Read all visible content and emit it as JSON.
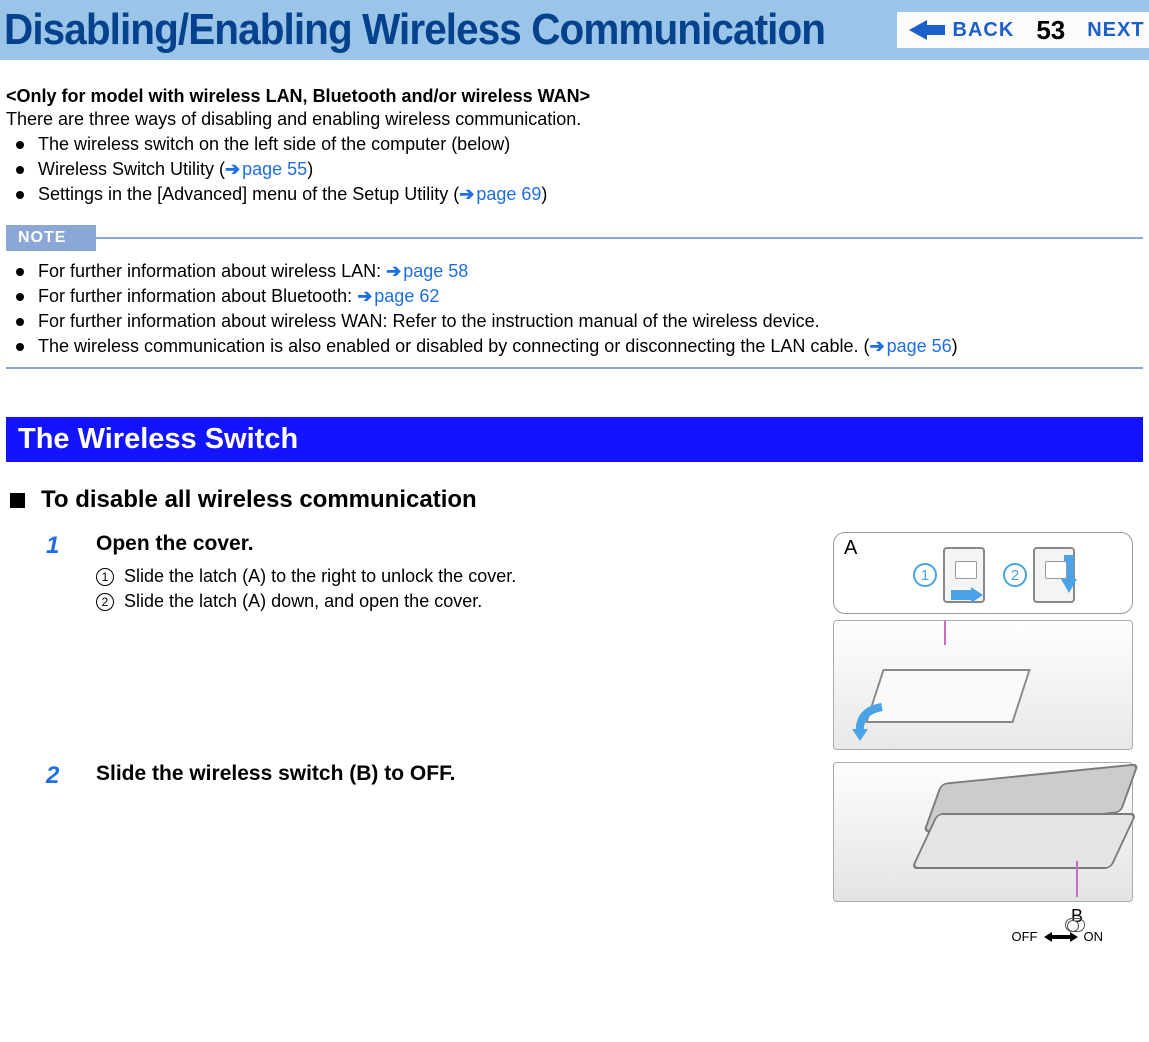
{
  "header": {
    "title": "Disabling/Enabling Wireless Communication",
    "back_label": "BACK",
    "next_label": "NEXT",
    "page_number": "53"
  },
  "intro": {
    "subtitle": "<Only for model with wireless LAN, Bluetooth and/or wireless WAN>",
    "line": "There are three ways of disabling and enabling wireless communication.",
    "bullets": [
      {
        "text": "The wireless switch on the left side of the computer (below)"
      },
      {
        "text_prefix": "Wireless Switch Utility (",
        "link": "page 55",
        "text_suffix": ")"
      },
      {
        "text_prefix": "Settings in the [Advanced] menu of the Setup Utility (",
        "link": "page 69",
        "text_suffix": ")"
      }
    ]
  },
  "note": {
    "label": "NOTE",
    "items": [
      {
        "text_prefix": "For further information about wireless LAN: ",
        "link": "page 58",
        "text_suffix": ""
      },
      {
        "text_prefix": "For further information about Bluetooth: ",
        "link": "page 62",
        "text_suffix": ""
      },
      {
        "text_prefix": "For further information about wireless WAN: Refer to the instruction manual of the wireless device.",
        "link": "",
        "text_suffix": ""
      },
      {
        "text_prefix": "The wireless communication is also enabled or disabled by connecting or disconnecting the LAN cable. (",
        "link": "page 56",
        "text_suffix": ")"
      }
    ]
  },
  "section": {
    "heading": "The Wireless Switch",
    "subheading": "To disable all wireless communication"
  },
  "steps": {
    "s1": {
      "num": "1",
      "title": "Open the cover.",
      "sub1_num": "1",
      "sub1_text": "Slide the latch (A) to the right to unlock the cover.",
      "sub2_num": "2",
      "sub2_text": "Slide the latch (A) down, and open the cover.",
      "illus_label": "A",
      "illus_c1": "1",
      "illus_c2": "2"
    },
    "s2": {
      "num": "2",
      "title": "Slide the wireless switch (B) to OFF.",
      "illus_label": "B",
      "off": "OFF",
      "on": "ON"
    }
  }
}
